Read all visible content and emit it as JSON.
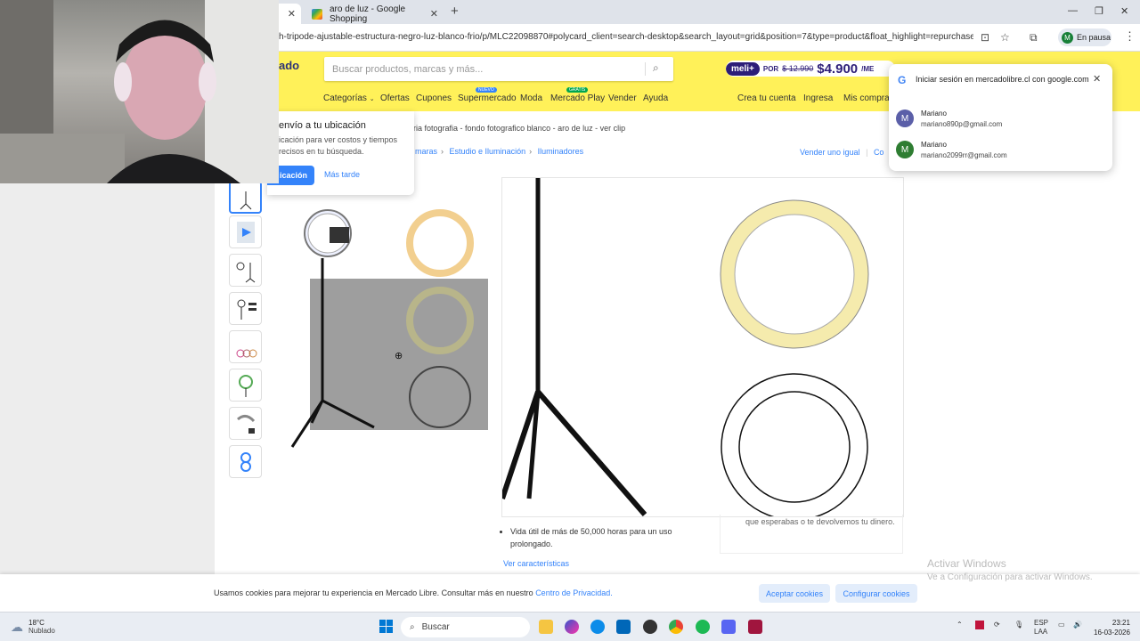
{
  "browser": {
    "tabs": [
      {
        "label": "",
        "active": true
      },
      {
        "label": "aro de luz - Google Shopping",
        "active": false
      }
    ],
    "url": "h-tripode-ajustable-estructura-negro-luz-blanco-frio/p/MLC22098870#polycard_client=search-desktop&search_layout=grid&position=7&type=product&float_highlight=repurchase&track...",
    "profile_status": "En pausa",
    "profile_initial": "M"
  },
  "header": {
    "logo_fragment": "ado",
    "search_placeholder": "Buscar productos, marcas y más...",
    "meli_tag": "meli+",
    "meli_por": "POR",
    "meli_old_price": "$ 12.990",
    "meli_new_price": "$4.900",
    "meli_suffix": "/ME",
    "nav": {
      "categorias": "Categorías",
      "ofertas": "Ofertas",
      "cupones": "Cupones",
      "supermercado": "Supermercado",
      "supermercado_badge": "NUEVO",
      "moda": "Moda",
      "mercado_play": "Mercado Play",
      "mercado_play_badge": "GRATIS",
      "vender": "Vender",
      "ayuda": "Ayuda",
      "crea_cuenta": "Crea tu cuenta",
      "ingresa": "Ingresa",
      "mis_compras": "Mis compras"
    }
  },
  "related_title": "oria fotografia - fondo fotografico blanco - aro de luz - ver clip",
  "breadcrumb": [
    "maras",
    "Estudio e Iluminación",
    "Iluminadores"
  ],
  "vender_igual": "Vender uno igual",
  "compartir_fragment": "Co",
  "location_popup": {
    "title": "envío a tu ubicación",
    "desc": "icación para ver costos y tiempos recisos en tu búsqueda.",
    "primary_btn": "icación",
    "secondary_btn": "Más tarde"
  },
  "google_popup": {
    "title": "Iniciar sesión en mercadolibre.cl con google.com",
    "accounts": [
      {
        "initial": "M",
        "name": "Mariano",
        "email": "mariano890p@gmail.com",
        "color": "#5b5fa8"
      },
      {
        "initial": "M",
        "name": "Mariano",
        "email": "mariano2099rr@gmail.com",
        "color": "#2e7d32"
      }
    ]
  },
  "product": {
    "bullet": "Vida útil de más de 50,000 horas para un uso prolongado.",
    "ver_caracteristicas": "Ver características",
    "right_text": "que esperabas o te devolvemos tu dinero."
  },
  "cookie": {
    "text": "Usamos cookies para mejorar tu experiencia en Mercado Libre. Consultar más en nuestro ",
    "link": "Centro de Privacidad.",
    "accept": "Aceptar cookies",
    "configure": "Configurar cookies"
  },
  "watermark": {
    "line1": "Activar Windows",
    "line2": "Ve a Configuración para activar Windows."
  },
  "taskbar": {
    "temp": "18°C",
    "weather": "Nublado",
    "search": "Buscar",
    "lang1": "ESP",
    "lang2": "LAA",
    "time": "23:21",
    "date": "16-03-2026"
  }
}
